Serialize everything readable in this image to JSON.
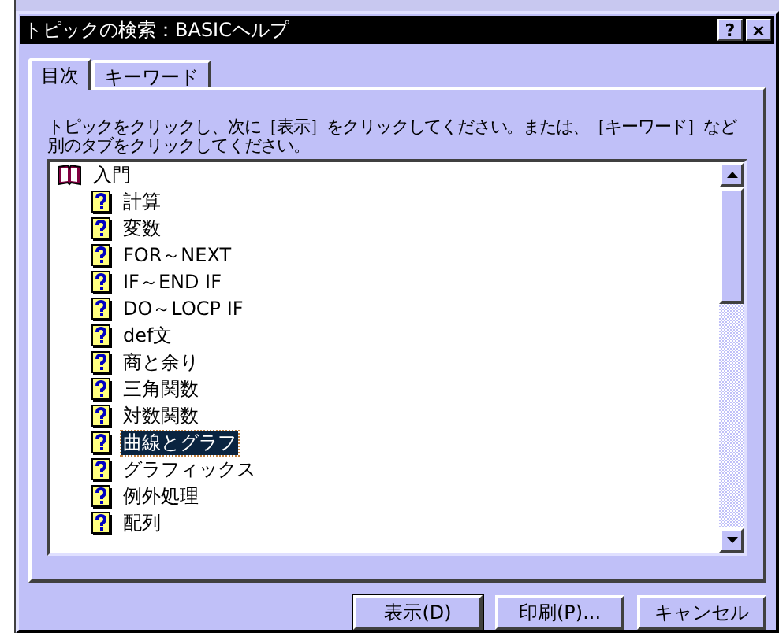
{
  "window": {
    "title": "トピックの検索：BASICヘルプ",
    "title_buttons": [
      "?",
      "×"
    ]
  },
  "tabs": [
    {
      "label": "目次",
      "selected": true
    },
    {
      "label": "キーワード",
      "selected": false
    }
  ],
  "instruction": "トピックをクリックし、次に［表示］をクリックしてください。または、［キーワード］など別のタブをクリックしてください。",
  "tree": [
    {
      "label": "入門",
      "kind": "book",
      "expanded": true,
      "selected": false,
      "children": [
        {
          "label": "計算",
          "kind": "topic",
          "selected": false
        },
        {
          "label": "変数",
          "kind": "topic",
          "selected": false
        },
        {
          "label": "FOR～NEXT",
          "kind": "topic",
          "selected": false
        },
        {
          "label": "IF～END IF",
          "kind": "topic",
          "selected": false
        },
        {
          "label": "DO～LOCP IF",
          "kind": "topic",
          "selected": false
        },
        {
          "label": "def文",
          "kind": "topic",
          "selected": false
        },
        {
          "label": "商と余り",
          "kind": "topic",
          "selected": false
        },
        {
          "label": "三角関数",
          "kind": "topic",
          "selected": false
        },
        {
          "label": "対数関数",
          "kind": "topic",
          "selected": false
        },
        {
          "label": "曲線とグラフ",
          "kind": "topic",
          "selected": true
        },
        {
          "label": "グラフィックス",
          "kind": "topic",
          "selected": false
        },
        {
          "label": "例外処理",
          "kind": "topic",
          "selected": false
        },
        {
          "label": "配列",
          "kind": "topic",
          "selected": false
        }
      ]
    }
  ],
  "buttons": [
    {
      "label": "表示(D)",
      "default": true
    },
    {
      "label": "印刷(P)...",
      "default": false
    },
    {
      "label": "キャンセル",
      "default": false
    }
  ]
}
